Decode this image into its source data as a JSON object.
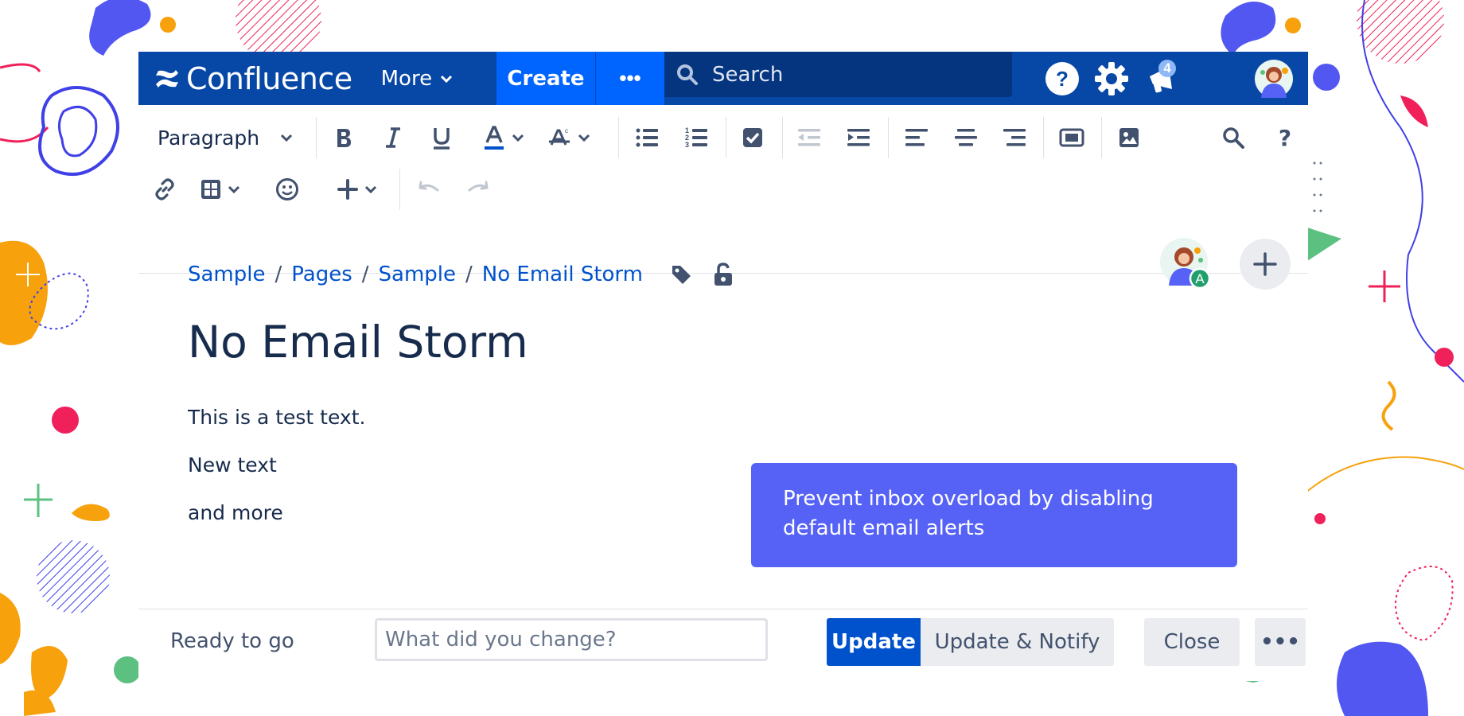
{
  "colors": {
    "topbar": "#0747a6",
    "create": "#0065ff",
    "search_bg": "#05357f",
    "primary_button": "#0052cc",
    "link": "#0052cc",
    "tooltip": "#5662f6",
    "text": "#172b4d",
    "presence_badge": "#22a06b"
  },
  "header": {
    "logo": "Confluence",
    "more_label": "More",
    "create_label": "Create",
    "create_more_label": "•••",
    "search_placeholder": "Search",
    "notification_count": "4",
    "icons": [
      "help-icon",
      "settings-icon",
      "notifications-icon",
      "user-avatar"
    ]
  },
  "toolbar": {
    "style_select": "Paragraph",
    "buttons": [
      "bold",
      "italic",
      "underline",
      "text-color",
      "clear-formatting",
      "bullet-list",
      "numbered-list",
      "task-list",
      "outdent",
      "indent",
      "align-left",
      "align-center",
      "align-right",
      "page-layout",
      "insert-image",
      "find-replace",
      "help",
      "link",
      "table",
      "emoji",
      "insert-more",
      "undo",
      "redo"
    ],
    "help_label": "?"
  },
  "page": {
    "breadcrumbs": [
      "Sample",
      "Pages",
      "Sample",
      "No Email Storm"
    ],
    "title": "No Email Storm",
    "paragraphs": [
      "This is a test text.",
      "New text",
      "and more"
    ],
    "collaborator_initial": "A"
  },
  "tooltip": {
    "text": "Prevent inbox overload by disabling default email alerts"
  },
  "footer": {
    "status": "Ready to go",
    "change_placeholder": "What did you change?",
    "update_label": "Update",
    "update_notify_label": "Update & Notify",
    "close_label": "Close",
    "more_label": "•••"
  }
}
